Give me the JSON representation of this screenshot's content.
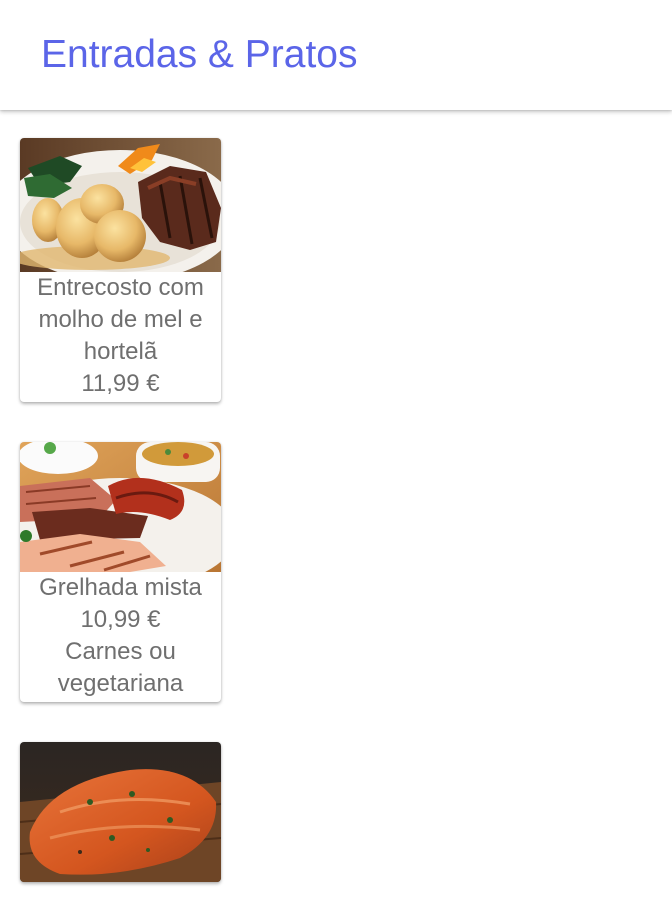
{
  "header": {
    "title": "Entradas & Pratos",
    "title_color": "#5b65e8"
  },
  "items": [
    {
      "image": "ribs-with-potatoes-photo",
      "name": "Entrecosto com molho de mel e hortelã",
      "price": "11,99 €"
    },
    {
      "image": "mixed-grill-photo",
      "name": "Grelhada mista",
      "price": "10,99 €",
      "note": "Carnes ou vegetariana"
    },
    {
      "image": "grilled-salmon-photo"
    }
  ]
}
